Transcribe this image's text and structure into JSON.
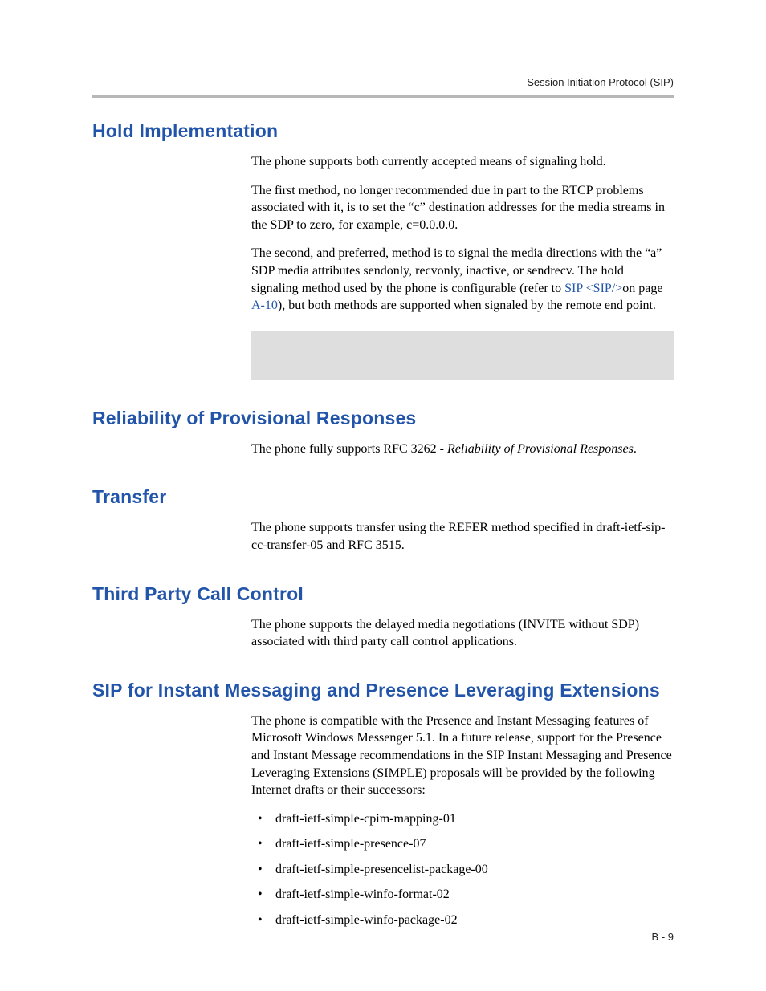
{
  "header": {
    "running_title": "Session Initiation Protocol (SIP)"
  },
  "sections": {
    "hold": {
      "title": "Hold Implementation",
      "p1": "The phone supports both currently accepted means of signaling hold.",
      "p2": "The first method, no longer recommended due in part to the RTCP problems associated with it, is to set the “c” destination addresses for the media streams in the SDP to zero, for example, c=0.0.0.0.",
      "p3_a": "The second, and preferred, method is to signal the media directions with the “a” SDP media attributes sendonly, recvonly, inactive, or sendrecv. The hold signaling method used by the phone is configurable (refer to ",
      "p3_link1": "SIP <SIP/>",
      "p3_b": "on page ",
      "p3_link2": "A-10",
      "p3_c": "), but both methods are supported when signaled by the remote end point."
    },
    "reliability": {
      "title": "Reliability of Provisional Responses",
      "p1_a": "The phone fully supports RFC 3262 - ",
      "p1_i": "Reliability of Provisional Responses",
      "p1_b": "."
    },
    "transfer": {
      "title": "Transfer",
      "p1": "The phone supports transfer using the REFER method specified in draft-ietf-sip-cc-transfer-05 and RFC 3515."
    },
    "third_party": {
      "title": "Third Party Call Control",
      "p1": "The phone supports the delayed media negotiations (INVITE without SDP) associated with third party call control applications."
    },
    "simple": {
      "title": "SIP for Instant Messaging and Presence Leveraging Extensions",
      "p1": "The phone is compatible with the Presence and Instant Messaging features of Microsoft Windows Messenger 5.1. In a future release, support for the Presence and Instant Message recommendations in the SIP Instant Messaging and Presence Leveraging Extensions (SIMPLE) proposals will be provided by the following Internet drafts or their successors:",
      "drafts": [
        "draft-ietf-simple-cpim-mapping-01",
        "draft-ietf-simple-presence-07",
        "draft-ietf-simple-presencelist-package-00",
        "draft-ietf-simple-winfo-format-02",
        "draft-ietf-simple-winfo-package-02"
      ]
    }
  },
  "footer": {
    "page_number": "B - 9"
  }
}
